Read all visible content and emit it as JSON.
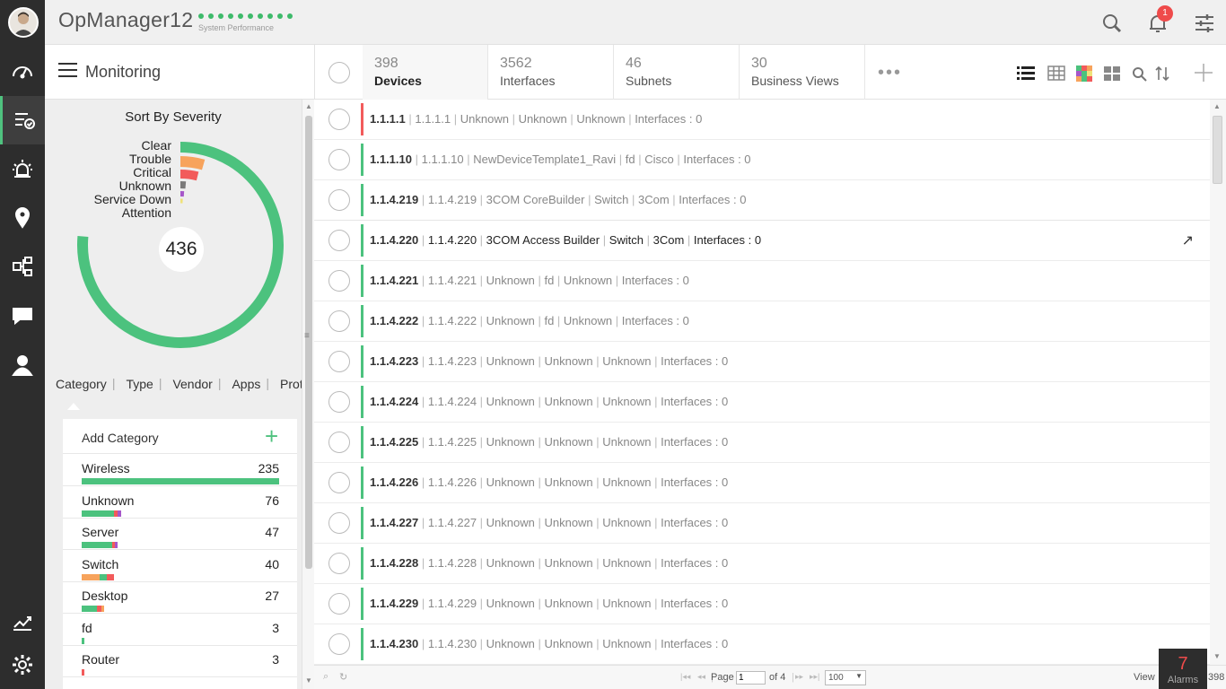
{
  "app": {
    "title": "OpManager12",
    "perf_label": "System Performance",
    "notif_count": "1"
  },
  "nav": {
    "items": [
      "dashboard-icon",
      "monitoring-icon",
      "alarms-icon",
      "maps-icon",
      "workflow-icon",
      "chat-icon",
      "user-icon",
      "reports-icon",
      "settings-icon"
    ]
  },
  "header": {
    "page_title": "Monitoring"
  },
  "tabs": [
    {
      "count": "398",
      "label": "Devices"
    },
    {
      "count": "3562",
      "label": "Interfaces"
    },
    {
      "count": "46",
      "label": "Subnets"
    },
    {
      "count": "30",
      "label": "Business Views"
    }
  ],
  "more": "•••",
  "severity": {
    "title": "Sort By Severity",
    "total": "436",
    "labels": [
      "Clear",
      "Trouble",
      "Critical",
      "Unknown",
      "Service Down",
      "Attention"
    ],
    "colors": {
      "Clear": "#4cc27e",
      "Trouble": "#f7a35c",
      "Critical": "#f25b5b",
      "Unknown": "#7a7a7a",
      "Service Down": "#a657c9",
      "Attention": "#f0e27a"
    }
  },
  "category_tabs": [
    "Category",
    "Type",
    "Vendor",
    "Apps",
    "Protocol"
  ],
  "category_panel": {
    "add_label": "Add Category",
    "add_symbol": "+"
  },
  "categories": [
    {
      "name": "Wireless",
      "count": "235"
    },
    {
      "name": "Unknown",
      "count": "76"
    },
    {
      "name": "Server",
      "count": "47"
    },
    {
      "name": "Switch",
      "count": "40"
    },
    {
      "name": "Desktop",
      "count": "27"
    },
    {
      "name": "fd",
      "count": "3"
    },
    {
      "name": "Router",
      "count": "3"
    }
  ],
  "devices": [
    {
      "name": "1.1.1.1",
      "ip": "1.1.1.1",
      "type": "Unknown",
      "cat": "Unknown",
      "vendor": "Unknown",
      "interfaces": "Interfaces : 0",
      "severity": "Critical"
    },
    {
      "name": "1.1.1.10",
      "ip": "1.1.1.10",
      "type": "NewDeviceTemplate1_Ravi",
      "cat": "fd",
      "vendor": "Cisco",
      "interfaces": "Interfaces : 0",
      "severity": "Clear"
    },
    {
      "name": "1.1.4.219",
      "ip": "1.1.4.219",
      "type": "3COM CoreBuilder",
      "cat": "Switch",
      "vendor": "3Com",
      "interfaces": "Interfaces : 0",
      "severity": "Clear"
    },
    {
      "name": "1.1.4.220",
      "ip": "1.1.4.220",
      "type": "3COM Access Builder",
      "cat": "Switch",
      "vendor": "3Com",
      "interfaces": "Interfaces : 0",
      "severity": "Clear"
    },
    {
      "name": "1.1.4.221",
      "ip": "1.1.4.221",
      "type": "Unknown",
      "cat": "fd",
      "vendor": "Unknown",
      "interfaces": "Interfaces : 0",
      "severity": "Clear"
    },
    {
      "name": "1.1.4.222",
      "ip": "1.1.4.222",
      "type": "Unknown",
      "cat": "fd",
      "vendor": "Unknown",
      "interfaces": "Interfaces : 0",
      "severity": "Clear"
    },
    {
      "name": "1.1.4.223",
      "ip": "1.1.4.223",
      "type": "Unknown",
      "cat": "Unknown",
      "vendor": "Unknown",
      "interfaces": "Interfaces : 0",
      "severity": "Clear"
    },
    {
      "name": "1.1.4.224",
      "ip": "1.1.4.224",
      "type": "Unknown",
      "cat": "Unknown",
      "vendor": "Unknown",
      "interfaces": "Interfaces : 0",
      "severity": "Clear"
    },
    {
      "name": "1.1.4.225",
      "ip": "1.1.4.225",
      "type": "Unknown",
      "cat": "Unknown",
      "vendor": "Unknown",
      "interfaces": "Interfaces : 0",
      "severity": "Clear"
    },
    {
      "name": "1.1.4.226",
      "ip": "1.1.4.226",
      "type": "Unknown",
      "cat": "Unknown",
      "vendor": "Unknown",
      "interfaces": "Interfaces : 0",
      "severity": "Clear"
    },
    {
      "name": "1.1.4.227",
      "ip": "1.1.4.227",
      "type": "Unknown",
      "cat": "Unknown",
      "vendor": "Unknown",
      "interfaces": "Interfaces : 0",
      "severity": "Clear"
    },
    {
      "name": "1.1.4.228",
      "ip": "1.1.4.228",
      "type": "Unknown",
      "cat": "Unknown",
      "vendor": "Unknown",
      "interfaces": "Interfaces : 0",
      "severity": "Clear"
    },
    {
      "name": "1.1.4.229",
      "ip": "1.1.4.229",
      "type": "Unknown",
      "cat": "Unknown",
      "vendor": "Unknown",
      "interfaces": "Interfaces : 0",
      "severity": "Clear"
    },
    {
      "name": "1.1.4.230",
      "ip": "1.1.4.230",
      "type": "Unknown",
      "cat": "Unknown",
      "vendor": "Unknown",
      "interfaces": "Interfaces : 0",
      "severity": "Clear"
    }
  ],
  "pagination": {
    "page_label": "Page",
    "page_value": "1",
    "of_label": "of 4",
    "per_page": "100",
    "view_label": "View",
    "view_suffix": "398"
  },
  "alarms": {
    "count": "7",
    "label": "Alarms"
  }
}
